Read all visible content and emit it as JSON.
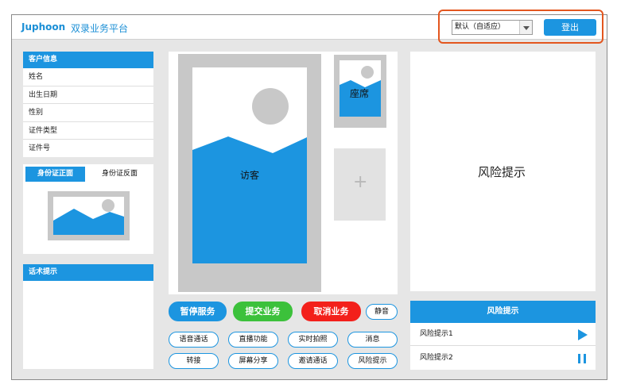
{
  "header": {
    "brand": "Juphoon",
    "subtitle": "双录业务平台",
    "layout_select": "默认（自适应）",
    "logout_label": "登出"
  },
  "customer_info": {
    "title": "客户信息",
    "fields": [
      "姓名",
      "出生日期",
      "性别",
      "证件类型",
      "证件号"
    ]
  },
  "id_card": {
    "front_tab": "身份证正面",
    "back_tab": "身份证反面"
  },
  "script_hint": {
    "title": "话术提示"
  },
  "video": {
    "visitor_label": "访客",
    "seat_label": "座席",
    "add_symbol": "+"
  },
  "risk_panel": {
    "label": "风险提示"
  },
  "actions": {
    "pause": "暂停服务",
    "submit": "提交业务",
    "cancel": "取消业务",
    "mute": "静音"
  },
  "functions": {
    "row1": [
      "语音通话",
      "直播功能",
      "实时拍照",
      "消息"
    ],
    "row2": [
      "转接",
      "屏幕分享",
      "邀请通话",
      "风险提示"
    ]
  },
  "risk_list": {
    "title": "风险提示",
    "items": [
      "风险提示1",
      "风险提示2"
    ]
  },
  "colors": {
    "primary": "#1c95e0",
    "green": "#3cc13b",
    "red": "#f3201b",
    "highlight": "#e3561f"
  },
  "icons": {
    "play": "play-icon",
    "pause": "pause-icon",
    "select_arrow": "chevron-down-icon"
  }
}
